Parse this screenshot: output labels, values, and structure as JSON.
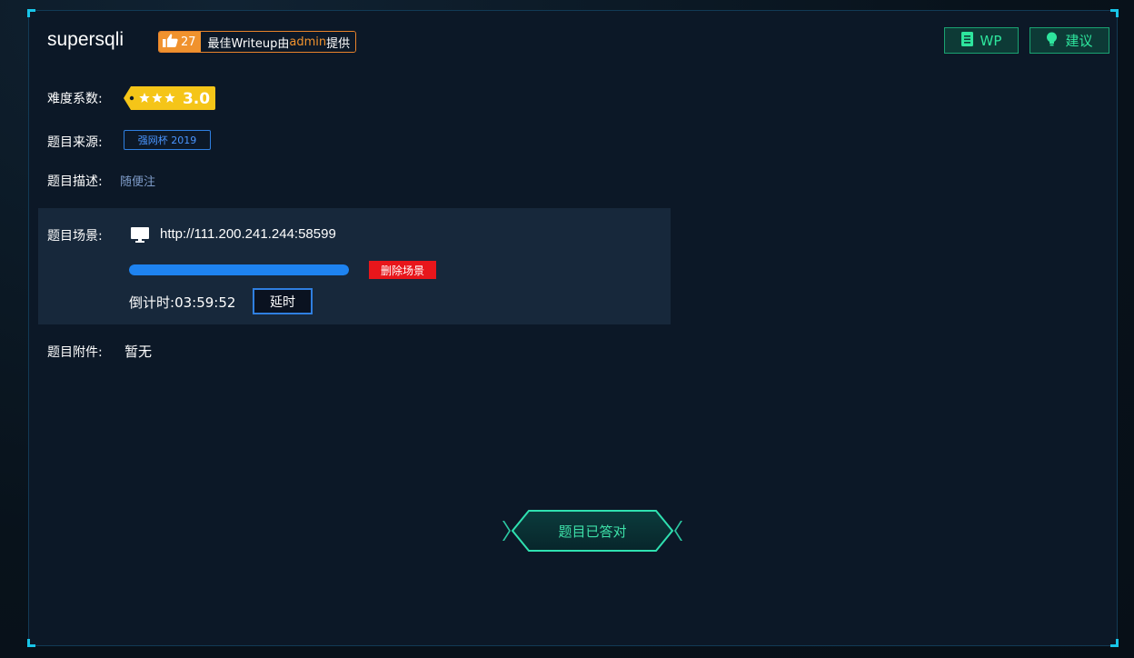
{
  "challenge": {
    "title": "supersqli",
    "likes": "27",
    "writeup_prefix": "最佳Writeup由",
    "writeup_author": "admin",
    "writeup_suffix": "提供"
  },
  "buttons": {
    "wp_label": "WP",
    "suggest_label": "建议",
    "delete_scene_label": "删除场景",
    "delay_label": "延时",
    "solved_label": "题目已答对"
  },
  "fields": {
    "difficulty_label": "难度系数:",
    "difficulty_value": "3.0",
    "difficulty_stars": 3,
    "source_label": "题目来源:",
    "source_value": "强网杯 2019",
    "description_label": "题目描述:",
    "description_value": "随便注",
    "scene_label": "题目场景:",
    "scene_url": "http://111.200.241.244:58599",
    "scene_progress_percent": 100,
    "countdown_label": "倒计时:",
    "countdown_value": "03:59:52",
    "attachment_label": "题目附件:",
    "attachment_value": "暂无"
  },
  "icons": {
    "like": "thumbs-up-icon",
    "wp": "document-icon",
    "suggest": "lightbulb-icon",
    "scene": "monitor-icon",
    "difficulty": "star-icon"
  },
  "colors": {
    "accent_orange": "#f0922e",
    "accent_green": "#2ee59d",
    "accent_blue": "#1e83f0",
    "danger": "#e8161b",
    "difficulty_tag": "#f5c518"
  }
}
